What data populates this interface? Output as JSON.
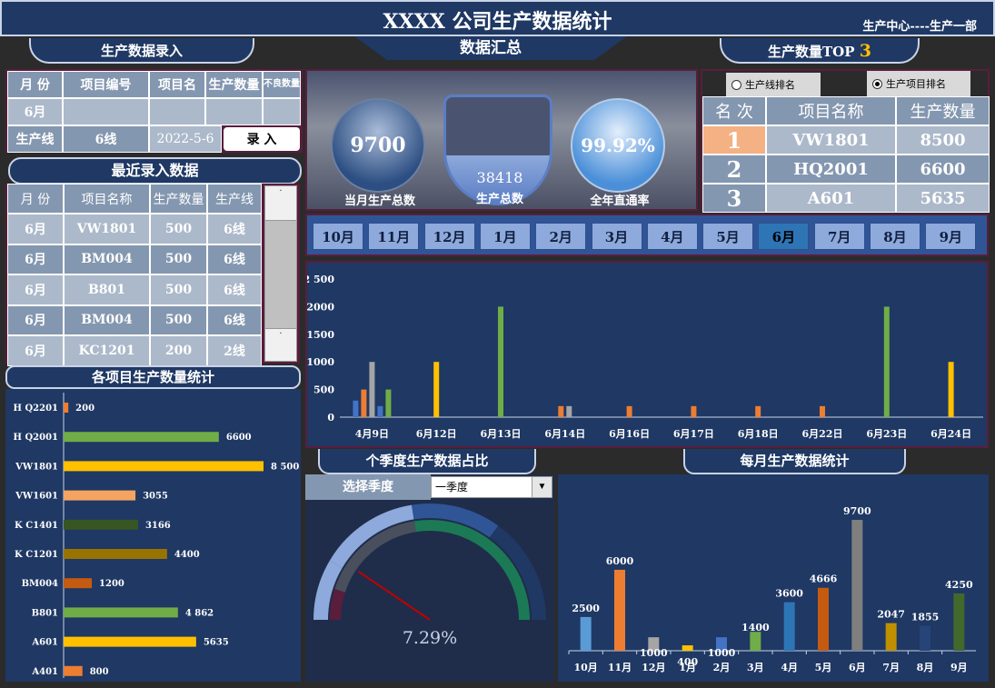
{
  "header": {
    "title": "XXXX  公司生产数据统计",
    "dept": "生产中心----生产一部"
  },
  "tabs": {
    "entry": "生产数据录入",
    "summary": "数据汇总",
    "top": "生产数量TOP",
    "top_num": "3"
  },
  "entry_form": {
    "headers": [
      "月 份",
      "项目编号",
      "项目名",
      "生产数量",
      "不良数量"
    ],
    "month": "6月",
    "line_label": "生产线",
    "line_value": "6线",
    "date": "2022-5-6",
    "submit": "录 入"
  },
  "recent": {
    "title": "最近录入数据",
    "headers": [
      "月 份",
      "项目名称",
      "生产数量",
      "生产线"
    ],
    "rows": [
      [
        "6月",
        "VW1801",
        "500",
        "6线"
      ],
      [
        "6月",
        "BM004",
        "500",
        "6线"
      ],
      [
        "6月",
        "B801",
        "500",
        "6线"
      ],
      [
        "6月",
        "BM004",
        "500",
        "6线"
      ],
      [
        "6月",
        "KC1201",
        "200",
        "2线"
      ]
    ],
    "scroll_up": "·",
    "scroll_down": "·"
  },
  "summary": {
    "monthly_total": "9700",
    "monthly_label": "当月生产总数",
    "total": "38418",
    "total_label": "生产总数",
    "rate": "99.92%",
    "rate_label": "全年直通率"
  },
  "top": {
    "radio_line": "生产线排名",
    "radio_project": "生产项目排名",
    "headers": [
      "名 次",
      "项目名称",
      "生产数量"
    ],
    "rows": [
      [
        "1",
        "VW1801",
        "8500"
      ],
      [
        "2",
        "HQ2001",
        "6600"
      ],
      [
        "3",
        "A601",
        "5635"
      ]
    ]
  },
  "months": [
    "10月",
    "11月",
    "12月",
    "1月",
    "2月",
    "3月",
    "4月",
    "5月",
    "6月",
    "7月",
    "8月",
    "9月"
  ],
  "active_month": "6月",
  "sections": {
    "project_stats": "各项目生产数量统计",
    "quarter": "个季度生产数据占比",
    "monthly": "每月生产数据统计"
  },
  "quarter": {
    "select_label": "选择季度",
    "selected": "一季度",
    "percent": "7.29%"
  },
  "chart_data": [
    {
      "type": "bar",
      "name": "daily",
      "categories": [
        "4月9日",
        "6月12日",
        "6月13日",
        "6月14日",
        "6月16日",
        "6月17日",
        "6月18日",
        "6月22日",
        "6月23日",
        "6月24日"
      ],
      "ylim": [
        0,
        2500
      ],
      "yticks": [
        "0",
        "500",
        "1000",
        "1500",
        "2000",
        "2 500"
      ],
      "groups": [
        [
          {
            "v": 300,
            "c": "#4472c4"
          },
          {
            "v": 500,
            "c": "#ed7d31"
          },
          {
            "v": 1000,
            "c": "#a5a5a5"
          },
          {
            "v": 200,
            "c": "#4472c4"
          },
          {
            "v": 500,
            "c": "#70ad47"
          }
        ],
        [
          {
            "v": 1000,
            "c": "#ffc000"
          }
        ],
        [
          {
            "v": 2000,
            "c": "#70ad47"
          }
        ],
        [
          {
            "v": 200,
            "c": "#ed7d31"
          },
          {
            "v": 200,
            "c": "#a5a5a5"
          }
        ],
        [
          {
            "v": 200,
            "c": "#ed7d31"
          }
        ],
        [
          {
            "v": 200,
            "c": "#ed7d31"
          }
        ],
        [
          {
            "v": 200,
            "c": "#ed7d31"
          }
        ],
        [
          {
            "v": 200,
            "c": "#ed7d31"
          }
        ],
        [
          {
            "v": 2000,
            "c": "#70ad47"
          }
        ],
        [
          {
            "v": 1000,
            "c": "#ffc000"
          }
        ]
      ]
    },
    {
      "type": "bar",
      "name": "projects",
      "orientation": "horizontal",
      "categories": [
        "H Q2201",
        "H Q2001",
        "VW1801",
        "VW1601",
        "K C1401",
        "K C1201",
        "BM004",
        "B801",
        "A601",
        "A401"
      ],
      "values": [
        200,
        6600,
        8500,
        3055,
        3166,
        4400,
        1200,
        4862,
        5635,
        800
      ],
      "labels": [
        "200",
        "6600",
        "8 500",
        "3055",
        "3166",
        "4400",
        "1200",
        "4 862",
        "5635",
        "800"
      ],
      "colors": [
        "#ed7d31",
        "#70ad47",
        "#ffc000",
        "#f4a460",
        "#375623",
        "#997300",
        "#c55a11",
        "#70ad47",
        "#ffc000",
        "#ed7d31"
      ],
      "xlim": [
        0,
        8500
      ]
    },
    {
      "type": "bar",
      "name": "monthly",
      "categories": [
        "10月",
        "11月",
        "12月",
        "1月",
        "2月",
        "3月",
        "4月",
        "5月",
        "6月",
        "7月",
        "8月",
        "9月"
      ],
      "values": [
        2500,
        6000,
        1000,
        400,
        1000,
        1400,
        3600,
        4666,
        9700,
        2047,
        1855,
        4250
      ],
      "colors": [
        "#5b9bd5",
        "#ed7d31",
        "#a5a5a5",
        "#ffc000",
        "#4472c4",
        "#70ad47",
        "#2e75b6",
        "#c55a11",
        "#7f7f7f",
        "#bf8f00",
        "#264478",
        "#43682b"
      ],
      "ylim": [
        0,
        9700
      ]
    },
    {
      "type": "gauge",
      "name": "quarter",
      "value": 7.29,
      "unit": "%"
    }
  ]
}
